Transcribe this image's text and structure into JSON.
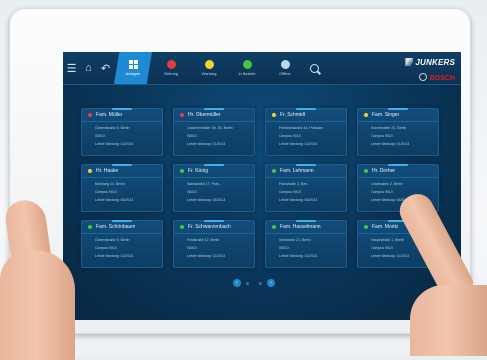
{
  "brand": {
    "junkers": "JUNKERS",
    "bosch": "BOSCH"
  },
  "tabs": [
    {
      "label": "Anlagen",
      "color": "#ffffff",
      "active": true
    },
    {
      "label": "Störung",
      "color": "#e53b3b"
    },
    {
      "label": "Wartung",
      "color": "#f2d22f"
    },
    {
      "label": "In Betrieb",
      "color": "#3ec83e"
    },
    {
      "label": "Offline",
      "color": "#bcd7ea"
    }
  ],
  "cards": [
    {
      "name": "Fam. Müller",
      "status": "#e53b3b",
      "street": "Gartenstraße 5, Berlin",
      "nr": "06010",
      "service": "Letzte Wartung: 01/2014"
    },
    {
      "name": "Hr. Obermüller",
      "status": "#e53b3b",
      "street": "Joachimsthaler Str. 30, Berlin",
      "nr": "06010",
      "service": "Letzte Wartung: 01/2014"
    },
    {
      "name": "Fr. Schmidt",
      "status": "#f2d22f",
      "street": "Friedrichstraße 44, Potsdam",
      "nr": "Campus 9010",
      "service": "Letzte Wartung: 01/2014"
    },
    {
      "name": "Fam. Singer",
      "status": "#f2d22f",
      "street": "Sonnenallee 21, Berlin",
      "nr": "Campus 9010",
      "service": "Letzte Wartung: 01/2014"
    },
    {
      "name": "Hr. Haake",
      "status": "#f2d22f",
      "street": "Mühlweg 14, Berlin",
      "nr": "Campus 9010",
      "service": "Letzte Wartung: 06/2013"
    },
    {
      "name": "Fr. König",
      "status": "#3ec83e",
      "street": "Waldstraße 17, Pots...",
      "nr": "06010",
      "service": "Letzte Wartung: 06/2013"
    },
    {
      "name": "Fam. Lehmann",
      "status": "#3ec83e",
      "street": "Parkstraße 3, Berl...",
      "nr": "Campus 9010",
      "service": "Letzte Wartung: 06/2013"
    },
    {
      "name": "Hr. Dreher",
      "status": "#3ec83e",
      "street": "Lindenallee 2, Berlin",
      "nr": "Campus 9010",
      "service": "Letzte Wartung: 06/2013"
    },
    {
      "name": "Fam. Schönbaum",
      "status": "#3ec83e",
      "street": "Gartenstraße 9, Berlin",
      "nr": "Campus 9010",
      "service": "Letzte Wartung: 11/2013"
    },
    {
      "name": "Fr. Schwarzenbach",
      "status": "#3ec83e",
      "street": "Feldstraße 12, Berlin",
      "nr": "06010",
      "service": "Letzte Wartung: 11/2013"
    },
    {
      "name": "Fam. Hasselmann",
      "status": "#3ec83e",
      "street": "Seestraße 21, Berlin",
      "nr": "06010",
      "service": "Letzte Wartung: 11/2013"
    },
    {
      "name": "Fam. Moritz",
      "status": "#3ec83e",
      "street": "Hauptstraße 1, Berlin",
      "nr": "Campus 9010",
      "service": "Letzte Wartung: 11/2013"
    }
  ],
  "pager": {
    "prev": "‹",
    "next": "›"
  }
}
